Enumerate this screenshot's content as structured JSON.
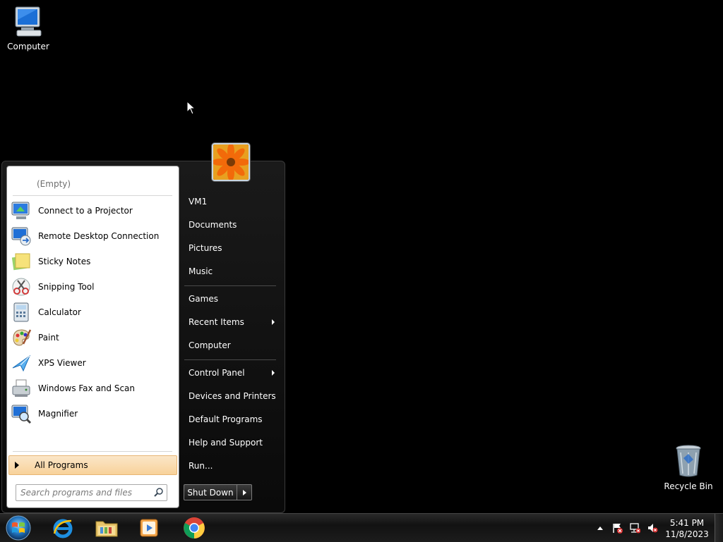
{
  "desktop": {
    "computer_label": "Computer",
    "recycle_label": "Recycle Bin"
  },
  "start_menu": {
    "empty_label": "(Empty)",
    "programs": [
      {
        "label": "Connect to a Projector",
        "icon": "projector-icon"
      },
      {
        "label": "Remote Desktop Connection",
        "icon": "remote-desktop-icon"
      },
      {
        "label": "Sticky Notes",
        "icon": "sticky-notes-icon"
      },
      {
        "label": "Snipping Tool",
        "icon": "scissors-icon"
      },
      {
        "label": "Calculator",
        "icon": "calculator-icon"
      },
      {
        "label": "Paint",
        "icon": "paint-palette-icon"
      },
      {
        "label": "XPS Viewer",
        "icon": "xps-viewer-icon"
      },
      {
        "label": "Windows Fax and Scan",
        "icon": "fax-icon"
      },
      {
        "label": "Magnifier",
        "icon": "magnifier-icon"
      }
    ],
    "all_programs": "All Programs",
    "search_placeholder": "Search programs and files",
    "right_items": [
      {
        "label": "VM1"
      },
      {
        "label": "Documents"
      },
      {
        "label": "Pictures"
      },
      {
        "label": "Music"
      },
      {
        "label": "Games"
      },
      {
        "label": "Recent Items",
        "submenu": true
      },
      {
        "label": "Computer"
      },
      {
        "label": "Control Panel",
        "submenu": true
      },
      {
        "label": "Devices and Printers"
      },
      {
        "label": "Default Programs"
      },
      {
        "label": "Help and Support"
      },
      {
        "label": "Run..."
      }
    ],
    "shutdown_label": "Shut Down"
  },
  "taskbar": {
    "pinned": [
      "internet-explorer-icon",
      "windows-explorer-icon",
      "media-player-icon",
      "chrome-icon"
    ],
    "clock_time": "5:41 PM",
    "clock_date": "11/8/2023"
  }
}
